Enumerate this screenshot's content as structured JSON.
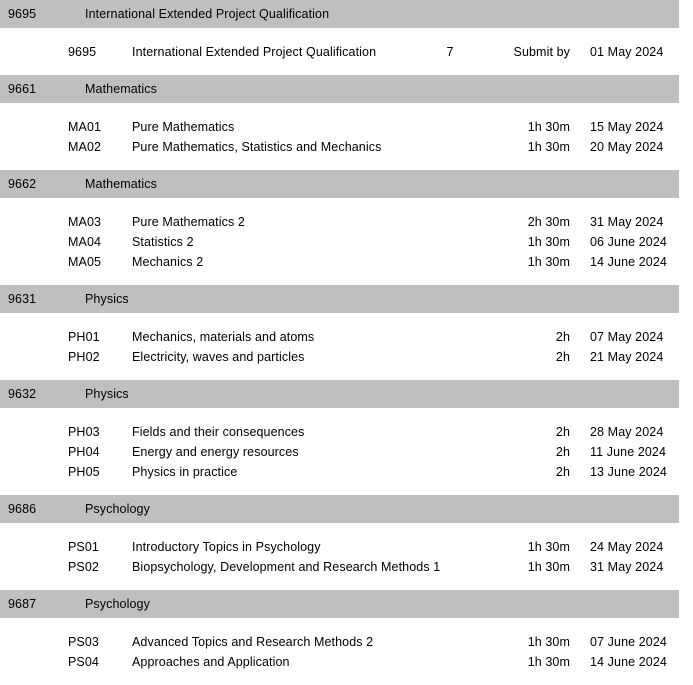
{
  "document": {
    "type": "exam-timetable",
    "columns": [
      "code",
      "title",
      "quantity",
      "duration",
      "date"
    ],
    "band_color": "#bfbfbf",
    "text_color": "#000000"
  },
  "groups": [
    {
      "code": "9695",
      "title": "International Extended Project Qualification",
      "rows": [
        {
          "code": "9695",
          "title": "International Extended Project Qualification",
          "qty": "7",
          "duration": "Submit by",
          "date": "01 May 2024"
        }
      ]
    },
    {
      "code": "9661",
      "title": "Mathematics",
      "rows": [
        {
          "code": "MA01",
          "title": "Pure Mathematics",
          "qty": "",
          "duration": "1h 30m",
          "date": "15 May 2024"
        },
        {
          "code": "MA02",
          "title": "Pure Mathematics, Statistics and Mechanics",
          "qty": "",
          "duration": "1h 30m",
          "date": "20 May 2024"
        }
      ]
    },
    {
      "code": "9662",
      "title": "Mathematics",
      "rows": [
        {
          "code": "MA03",
          "title": "Pure Mathematics 2",
          "qty": "",
          "duration": "2h 30m",
          "date": "31 May 2024"
        },
        {
          "code": "MA04",
          "title": "Statistics 2",
          "qty": "",
          "duration": "1h 30m",
          "date": "06 June 2024"
        },
        {
          "code": "MA05",
          "title": "Mechanics 2",
          "qty": "",
          "duration": "1h 30m",
          "date": "14 June 2024"
        }
      ]
    },
    {
      "code": "9631",
      "title": "Physics",
      "rows": [
        {
          "code": "PH01",
          "title": "Mechanics, materials and atoms",
          "qty": "",
          "duration": "2h",
          "date": "07 May 2024"
        },
        {
          "code": "PH02",
          "title": "Electricity, waves and particles",
          "qty": "",
          "duration": "2h",
          "date": "21 May 2024"
        }
      ]
    },
    {
      "code": "9632",
      "title": "Physics",
      "rows": [
        {
          "code": "PH03",
          "title": "Fields and their consequences",
          "qty": "",
          "duration": "2h",
          "date": "28 May 2024"
        },
        {
          "code": "PH04",
          "title": "Energy and energy resources",
          "qty": "",
          "duration": "2h",
          "date": "11 June 2024"
        },
        {
          "code": "PH05",
          "title": "Physics in practice",
          "qty": "",
          "duration": "2h",
          "date": "13 June 2024"
        }
      ]
    },
    {
      "code": "9686",
      "title": "Psychology",
      "rows": [
        {
          "code": "PS01",
          "title": "Introductory Topics in Psychology",
          "qty": "",
          "duration": "1h 30m",
          "date": "24 May 2024"
        },
        {
          "code": "PS02",
          "title": "Biopsychology, Development and Research Methods 1",
          "qty": "",
          "duration": "1h 30m",
          "date": "31 May 2024"
        }
      ]
    },
    {
      "code": "9687",
      "title": "Psychology",
      "rows": [
        {
          "code": "PS03",
          "title": "Advanced Topics and Research Methods 2",
          "qty": "",
          "duration": "1h 30m",
          "date": "07 June 2024"
        },
        {
          "code": "PS04",
          "title": "Approaches and Application",
          "qty": "",
          "duration": "1h 30m",
          "date": "14 June 2024"
        }
      ]
    }
  ]
}
